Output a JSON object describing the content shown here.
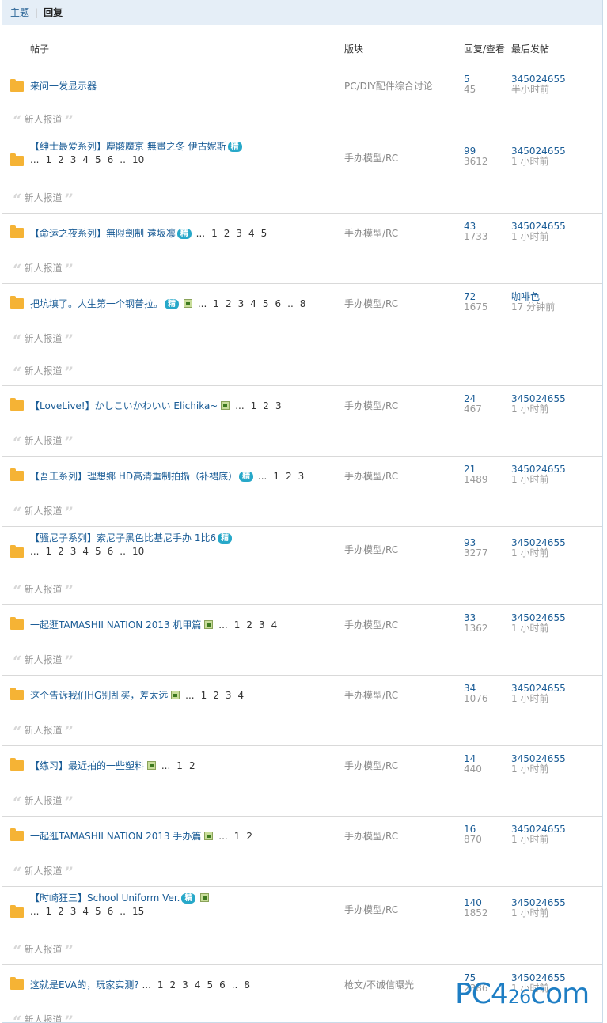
{
  "tabs": {
    "topic": "主题",
    "reply": "回复"
  },
  "headers": {
    "post": "帖子",
    "forum": "版块",
    "counts": "回复/查看",
    "last": "最后发帖"
  },
  "quote_text": "新人报道",
  "rows": [
    {
      "title": "来问一发显示器",
      "forum": "PC/DIY配件综合讨论",
      "replies": "5",
      "views": "45",
      "user": "345024655",
      "time": "半小时前"
    },
    {
      "title": "【绅士最爱系列】塵骸魔京 無畫之冬 伊古妮斯",
      "jing": "精",
      "pages": [
        "...",
        "1",
        "2",
        "3",
        "4",
        "5",
        "6",
        "..",
        "10"
      ],
      "forum": "手办模型/RC",
      "replies": "99",
      "views": "3612",
      "user": "345024655",
      "time": "1 小时前"
    },
    {
      "title": "【命运之夜系列】無限劍制 遠坂凛",
      "jing": "精",
      "inline_pages": [
        "...",
        "1",
        "2",
        "3",
        "4",
        "5"
      ],
      "forum": "手办模型/RC",
      "replies": "43",
      "views": "1733",
      "user": "345024655",
      "time": "1 小时前"
    },
    {
      "title": "把坑填了。人生第一个钢普拉。",
      "jing": "精",
      "img": true,
      "inline_pages": [
        "...",
        "1",
        "2",
        "3",
        "4",
        "5",
        "6",
        "..",
        "8"
      ],
      "forum": "手办模型/RC",
      "replies": "72",
      "views": "1675",
      "user": "咖啡色",
      "time": "17 分钟前"
    },
    {
      "title": "【LoveLive!】かしこいかわいい Elichika~",
      "img": true,
      "inline_pages": [
        "...",
        "1",
        "2",
        "3"
      ],
      "forum": "手办模型/RC",
      "replies": "24",
      "views": "467",
      "user": "345024655",
      "time": "1 小时前"
    },
    {
      "title": "【吾王系列】理想鄉 HD高清重制拍攝（补裙底）",
      "jing": "精",
      "inline_pages": [
        "...",
        "1",
        "2",
        "3"
      ],
      "forum": "手办模型/RC",
      "replies": "21",
      "views": "1489",
      "user": "345024655",
      "time": "1 小时前"
    },
    {
      "title": "【骚尼子系列】索尼子黑色比基尼手办 1比6",
      "jing": "精",
      "pages": [
        "...",
        "1",
        "2",
        "3",
        "4",
        "5",
        "6",
        "..",
        "10"
      ],
      "forum": "手办模型/RC",
      "replies": "93",
      "views": "3277",
      "user": "345024655",
      "time": "1 小时前"
    },
    {
      "title": "一起逛TAMASHII NATION 2013 机甲篇",
      "img": true,
      "inline_pages": [
        "...",
        "1",
        "2",
        "3",
        "4"
      ],
      "forum": "手办模型/RC",
      "replies": "33",
      "views": "1362",
      "user": "345024655",
      "time": "1 小时前"
    },
    {
      "title": "这个告诉我们HG别乱买，差太远",
      "img": true,
      "inline_pages": [
        "...",
        "1",
        "2",
        "3",
        "4"
      ],
      "forum": "手办模型/RC",
      "replies": "34",
      "views": "1076",
      "user": "345024655",
      "time": "1 小时前"
    },
    {
      "title": "【练习】最近拍的一些塑料",
      "img": true,
      "inline_pages": [
        "...",
        "1",
        "2"
      ],
      "forum": "手办模型/RC",
      "replies": "14",
      "views": "440",
      "user": "345024655",
      "time": "1 小时前"
    },
    {
      "title": "一起逛TAMASHII NATION 2013 手办篇",
      "img": true,
      "inline_pages": [
        "...",
        "1",
        "2"
      ],
      "forum": "手办模型/RC",
      "replies": "16",
      "views": "870",
      "user": "345024655",
      "time": "1 小时前"
    },
    {
      "title": "【时崎狂三】School Uniform Ver.",
      "jing": "精",
      "img": true,
      "pages": [
        "...",
        "1",
        "2",
        "3",
        "4",
        "5",
        "6",
        "..",
        "15"
      ],
      "forum": "手办模型/RC",
      "replies": "140",
      "views": "1852",
      "user": "345024655",
      "time": "1 小时前"
    },
    {
      "title": "这就是EVA的，玩家实测?",
      "inline_pages": [
        "...",
        "1",
        "2",
        "3",
        "4",
        "5",
        "6",
        "..",
        "8"
      ],
      "forum": "枪文/不诚信曝光",
      "replies": "75",
      "views": "2386",
      "user": "345024655",
      "time": "1 小时前"
    }
  ],
  "watermark": {
    "main": "PC4",
    "mid": "26",
    "tail": "com"
  }
}
